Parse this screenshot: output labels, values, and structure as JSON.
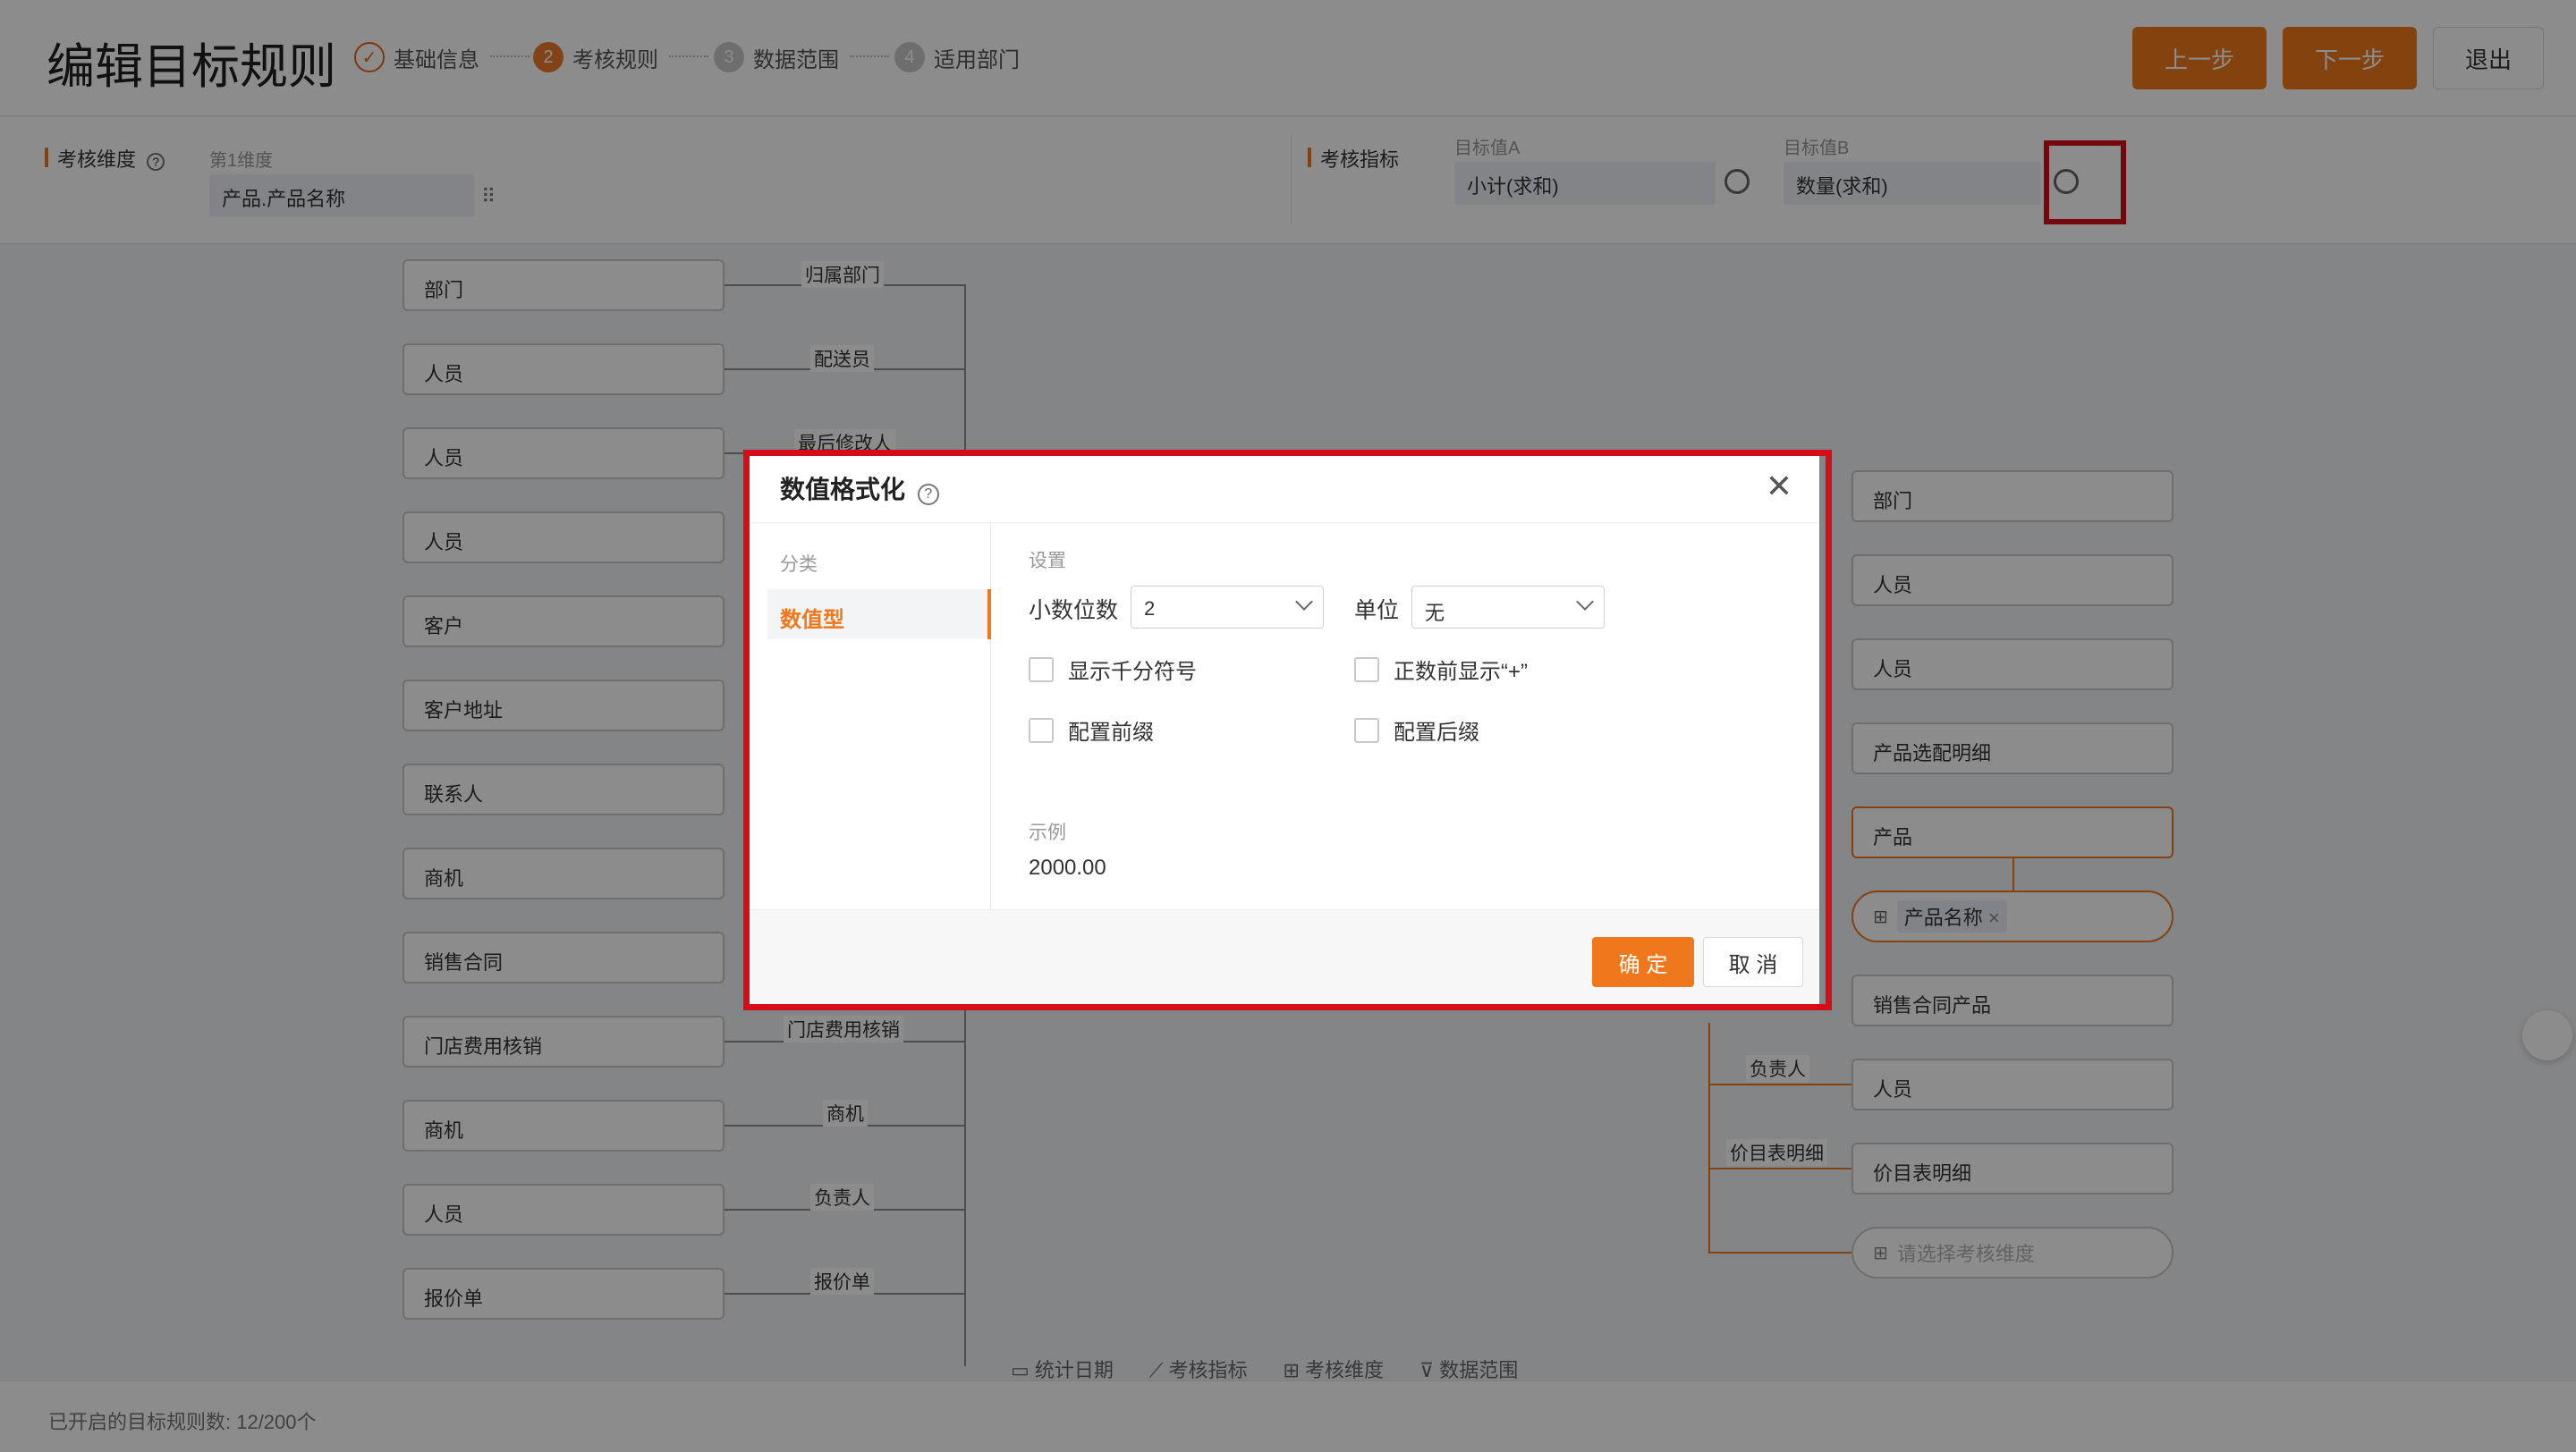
{
  "header": {
    "title": "编辑目标规则",
    "steps": [
      {
        "num": "✓",
        "label": "基础信息"
      },
      {
        "num": "2",
        "label": "考核规则"
      },
      {
        "num": "3",
        "label": "数据范围"
      },
      {
        "num": "4",
        "label": "适用部门"
      }
    ],
    "prev_label": "上一步",
    "next_label": "下一步",
    "exit_label": "退出"
  },
  "config": {
    "dimension_label": "考核维度",
    "dimension_sub": "第1维度",
    "dimension_value": "产品.产品名称",
    "metric_label": "考核指标",
    "target_a_label": "目标值A",
    "target_a_value": "小计(求和)",
    "target_b_label": "目标值B",
    "target_b_value": "数量(求和)"
  },
  "flow": {
    "left_nodes": [
      "部门",
      "人员",
      "人员",
      "人员",
      "客户",
      "客户地址",
      "联系人",
      "商机",
      "销售合同",
      "门店费用核销",
      "商机",
      "人员",
      "报价单"
    ],
    "left_edge_labels": [
      "归属部门",
      "配送员",
      "最后修改人",
      "门店费用核销",
      "商机",
      "负责人",
      "报价单"
    ],
    "right_nodes": [
      "部门",
      "人员",
      "人员",
      "产品选配明细",
      "产品",
      "销售合同产品",
      "人员",
      "价目表明细"
    ],
    "right_edge_labels": [
      "负责人",
      "价目表明细"
    ],
    "product_pill_tag": "产品名称",
    "select_dimension_placeholder": "请选择考核维度"
  },
  "bottom_tabs": [
    "统计日期",
    "考核指标",
    "考核维度",
    "数据范围"
  ],
  "footer": {
    "text": "已开启的目标规则数: 12/200个"
  },
  "dialog": {
    "title": "数值格式化",
    "category_label": "分类",
    "category_item": "数值型",
    "settings_label": "设置",
    "decimals_label": "小数位数",
    "decimals_value": "2",
    "unit_label": "单位",
    "unit_value": "无",
    "thousands_label": "显示千分符号",
    "plus_label": "正数前显示“+”",
    "prefix_label": "配置前缀",
    "suffix_label": "配置后缀",
    "example_label": "示例",
    "example_value": "2000.00",
    "ok_label": "确 定",
    "cancel_label": "取 消"
  }
}
